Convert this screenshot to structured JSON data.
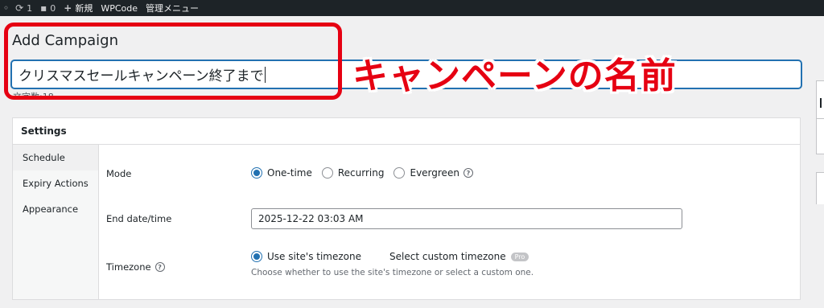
{
  "adminbar": {
    "updates_count": "1",
    "comments_count": "0",
    "new_label": "新規",
    "plugin_label": "WPCode",
    "menu_label": "管理メニュー"
  },
  "page": {
    "title": "Add Campaign",
    "campaign_name": "クリスマスセールキャンペーン終了まで",
    "char_count": "文字数:18"
  },
  "annotation": {
    "text": "キャンペーンの名前",
    "color": "#e60012"
  },
  "settings": {
    "heading": "Settings",
    "tabs": [
      {
        "label": "Schedule",
        "active": true
      },
      {
        "label": "Expiry Actions",
        "active": false
      },
      {
        "label": "Appearance",
        "active": false
      }
    ],
    "mode": {
      "label": "Mode",
      "options": [
        "One-time",
        "Recurring",
        "Evergreen"
      ],
      "selected": "One-time"
    },
    "end_datetime": {
      "label": "End date/time",
      "value": "2025-12-22 03:03 AM"
    },
    "timezone": {
      "label": "Timezone",
      "option_site": "Use site's timezone",
      "option_custom": "Select custom timezone",
      "pro_badge": "Pro",
      "description": "Choose whether to use the site's timezone or select a custom one."
    }
  },
  "colors": {
    "accent": "#2271b1",
    "adminbar_bg": "#1d2327"
  }
}
